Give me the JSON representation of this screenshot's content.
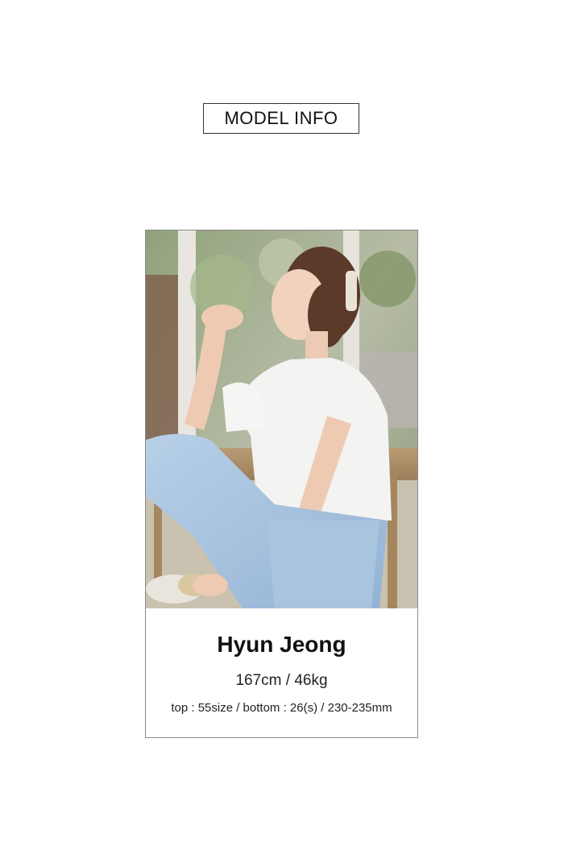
{
  "section_title": "MODEL INFO",
  "model": {
    "name": "Hyun Jeong",
    "stats": "167cm / 46kg",
    "sizes": "top : 55size / bottom : 26(s) / 230-235mm"
  },
  "photo": {
    "subject": "model-photo"
  },
  "colors": {
    "frame_border": "#8a8a8a",
    "title_border": "#333333",
    "text": "#111111",
    "top_color": "#f3f3f1",
    "denim_color": "#a9c4de"
  }
}
